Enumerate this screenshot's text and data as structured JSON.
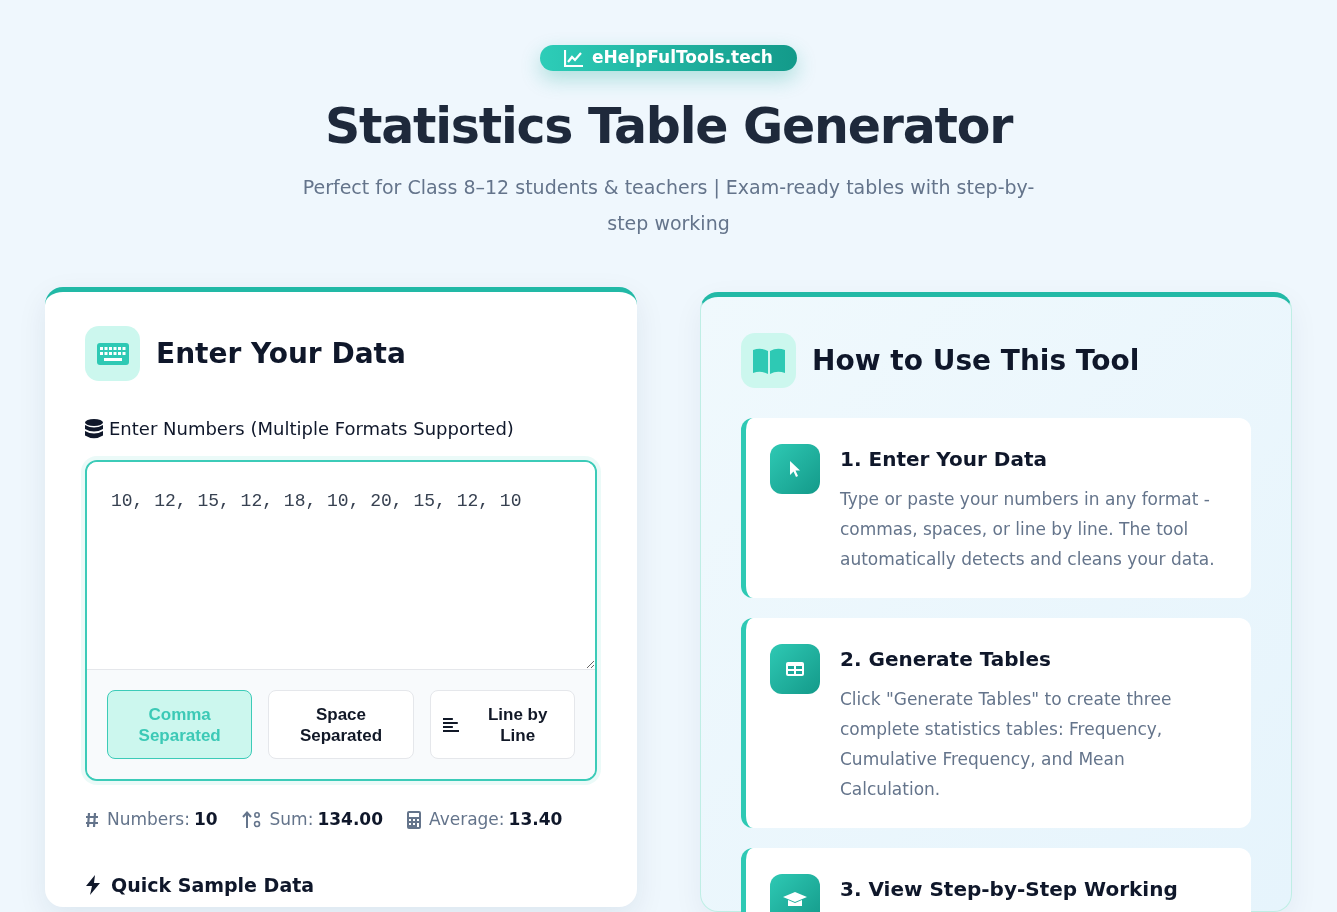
{
  "brand": "eHelpFulTools.tech",
  "title": "Statistics Table Generator",
  "subtitle": "Perfect for Class 8–12 students & teachers | Exam-ready tables with step-by-step working",
  "input_panel": {
    "heading": "Enter Your Data",
    "field_label": "Enter Numbers (Multiple Formats Supported)",
    "value": "10, 12, 15, 12, 18, 10, 20, 15, 12, 10",
    "formats": [
      {
        "kind": "comma",
        "label": "Comma Separated",
        "selected": true
      },
      {
        "kind": "space",
        "label": "Space Separated",
        "selected": false
      },
      {
        "kind": "lines",
        "label": "Line by Line",
        "selected": false
      }
    ],
    "stats": [
      {
        "kind": "count",
        "label": "Numbers:",
        "value": "10"
      },
      {
        "kind": "sum",
        "label": "Sum:",
        "value": "134.00"
      },
      {
        "kind": "average",
        "label": "Average:",
        "value": "13.40"
      }
    ],
    "samples_heading": "Quick Sample Data"
  },
  "guide": {
    "heading": "How to Use This Tool",
    "steps": [
      {
        "kind": "pointer",
        "title": "1. Enter Your Data",
        "text": "Type or paste your numbers in any format - commas, spaces, or line by line. The tool automatically detects and cleans your data."
      },
      {
        "kind": "table",
        "title": "2. Generate Tables",
        "text": "Click \"Generate Tables\" to create three complete statistics tables: Frequency, Cumulative Frequency, and Mean Calculation."
      },
      {
        "kind": "cap",
        "title": "3. View Step-by-Step Working"
      }
    ]
  }
}
